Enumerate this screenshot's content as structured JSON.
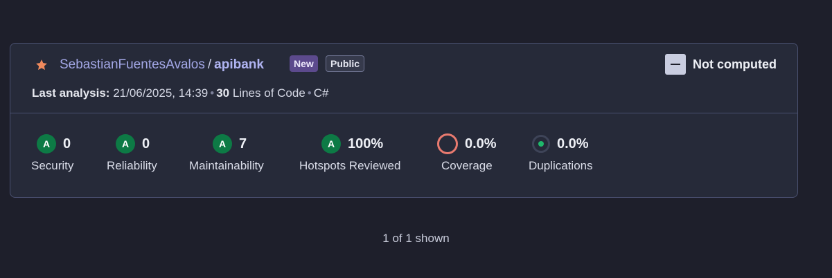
{
  "project": {
    "organization": "SebastianFuentesAvalos",
    "separator": "/",
    "name": "apibank",
    "badges": {
      "new": "New",
      "public": "Public"
    },
    "quality_gate": "Not computed",
    "meta": {
      "last_analysis_label": "Last analysis:",
      "last_analysis_value": "21/06/2025, 14:39",
      "loc_value": "30",
      "loc_label": "Lines of Code",
      "language": "C#"
    }
  },
  "metrics": [
    {
      "grade": "A",
      "value": "0",
      "label": "Security"
    },
    {
      "grade": "A",
      "value": "0",
      "label": "Reliability"
    },
    {
      "grade": "A",
      "value": "7",
      "label": "Maintainability"
    },
    {
      "grade": "A",
      "value": "100%",
      "label": "Hotspots Reviewed"
    },
    {
      "value": "0.0%",
      "label": "Coverage"
    },
    {
      "value": "0.0%",
      "label": "Duplications"
    }
  ],
  "footer": {
    "shown": "1 of 1 shown"
  },
  "colors": {
    "grade_a": "#0d7a45",
    "coverage_ring": "#e87a6f",
    "duplication_dot": "#1fb86b",
    "star": "#f08a5d"
  }
}
